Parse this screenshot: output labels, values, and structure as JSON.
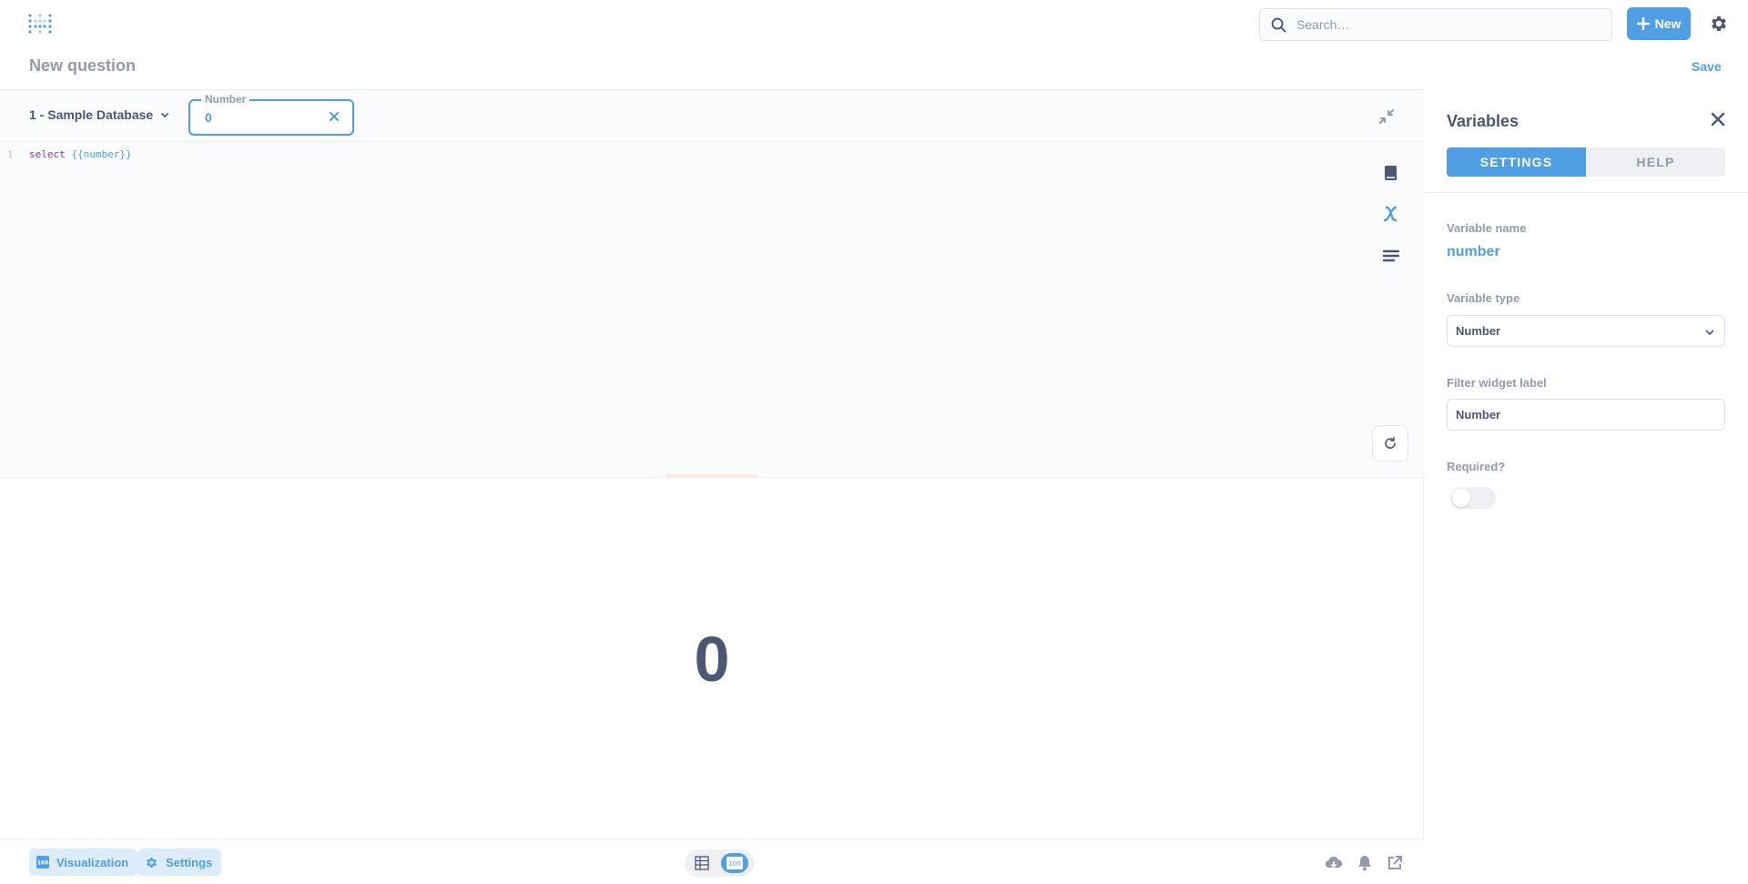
{
  "nav": {
    "search_placeholder": "Search…",
    "new_label": "New"
  },
  "header": {
    "title": "New question",
    "save_label": "Save"
  },
  "editor": {
    "database": "1 - Sample Database",
    "widget_label": "Number",
    "widget_value": "0",
    "line_number": "1",
    "code_keyword": "select",
    "code_tag": "{{number}}"
  },
  "result": {
    "value": "0"
  },
  "footer": {
    "visualization_label": "Visualization",
    "settings_label": "Settings"
  },
  "panel": {
    "title": "Variables",
    "tabs": [
      "SETTINGS",
      "HELP"
    ],
    "variable_name_label": "Variable name",
    "variable_name": "number",
    "variable_type_label": "Variable type",
    "variable_type": "Number",
    "filter_label_label": "Filter widget label",
    "filter_label": "Number",
    "required_label": "Required?"
  },
  "colors": {
    "brand": "#509ee3",
    "text": "#4c5773",
    "muted": "#949aab"
  }
}
